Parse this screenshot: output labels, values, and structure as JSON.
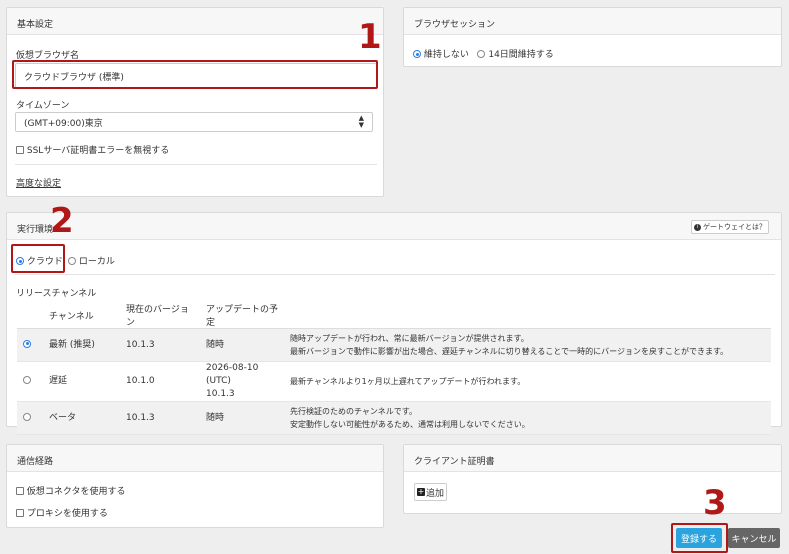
{
  "basic": {
    "title": "基本設定",
    "browser_name_label": "仮想ブラウザ名",
    "browser_name_value": "クラウドブラウザ (標準)",
    "timezone_label": "タイムゾーン",
    "timezone_value": "(GMT+09:00)東京",
    "ssl_label": "SSLサーバ証明書エラーを無視する",
    "advanced_link": "高度な設定"
  },
  "session": {
    "title": "ブラウザセッション",
    "option_no": "維持しない",
    "option_14": "14日間維持する"
  },
  "env": {
    "title": "実行環境",
    "gateway_button": "ゲートウェイとは？",
    "opt_cloud": "クラウド",
    "opt_local": "ローカル",
    "release_label": "リリースチャンネル",
    "headers": [
      "チャンネル",
      "現在のバージョン",
      "アップデートの予定"
    ],
    "rows": [
      {
        "channel": "最新 (推奨)",
        "version": "10.1.3",
        "update": "随時",
        "update2": "",
        "desc1": "随時アップデートが行われ、常に最新バージョンが提供されます。",
        "desc2": "最新バージョンで動作に影響が出た場合、遅延チャンネルに切り替えることで一時的にバージョンを戻すことができます。"
      },
      {
        "channel": "遅延",
        "version": "10.1.0",
        "update": "2026-08-10 (UTC)",
        "update2": "10.1.3",
        "desc1": "最新チャンネルより1ヶ月以上遅れてアップデートが行われます。",
        "desc2": ""
      },
      {
        "channel": "ベータ",
        "version": "10.1.3",
        "update": "随時",
        "update2": "",
        "desc1": "先行検証のためのチャンネルです。",
        "desc2": "安定動作しない可能性があるため、通常は利用しないでください。"
      }
    ]
  },
  "route": {
    "title": "通信経路",
    "opt_connector": "仮想コネクタを使用する",
    "opt_proxy": "プロキシを使用する"
  },
  "cert": {
    "title": "クライアント証明書",
    "add_button": "追加"
  },
  "footer": {
    "register": "登録する",
    "cancel": "キャンセル"
  },
  "markers": [
    "1",
    "2",
    "3"
  ]
}
